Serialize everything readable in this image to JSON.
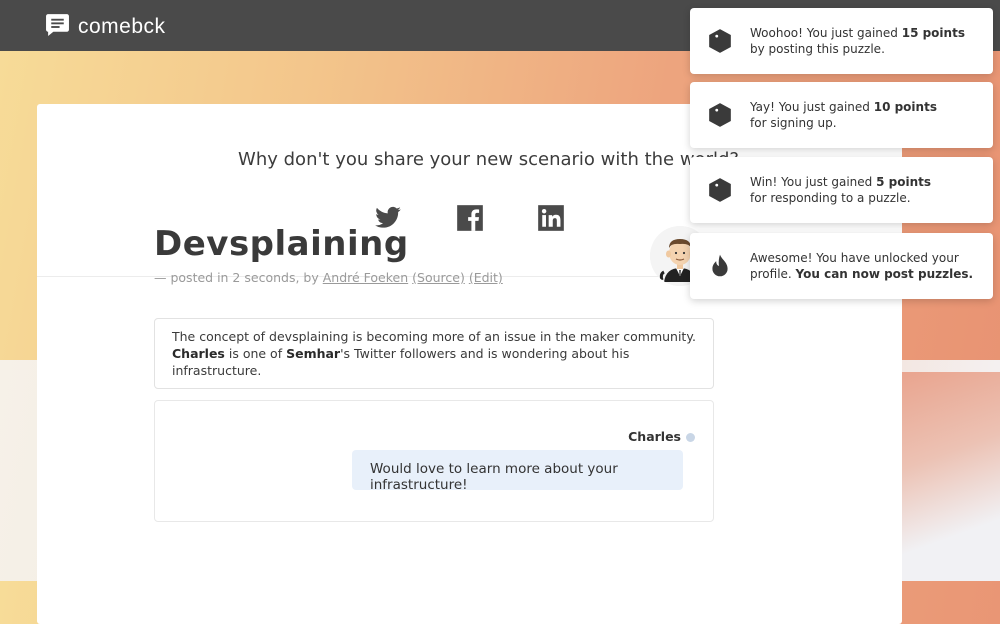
{
  "app": {
    "name": "comebck"
  },
  "share": {
    "prompt": "Why don't you share your new scenario with the world?",
    "icons": [
      "twitter-icon",
      "facebook-icon",
      "linkedin-icon"
    ]
  },
  "post": {
    "title": "Devsplaining",
    "meta_prefix": "— posted in 2 seconds, by",
    "author": "André Foeken",
    "source_label": "(Source)",
    "edit_label": "(Edit)"
  },
  "description": {
    "part1": "The concept of devsplaining is becoming more of an issue in the maker community.",
    "name1": "Charles",
    "part2": "is one of",
    "name2": "Semhar",
    "part3": "'s Twitter followers and is wondering about his infrastructure."
  },
  "chat": {
    "author": "Charles",
    "message": "Would love to learn more about your infrastructure!"
  },
  "notifications": [
    {
      "icon": "cube-icon",
      "line1": "Woohoo! You just gained",
      "bold": "15 points",
      "line2": "by posting this puzzle."
    },
    {
      "icon": "cube-icon",
      "line1": "Yay! You just gained",
      "bold": "10 points",
      "line2": "for signing up."
    },
    {
      "icon": "cube-icon",
      "line1": "Win! You just gained",
      "bold": "5 points",
      "line2": "for responding to a puzzle."
    },
    {
      "icon": "flame-icon",
      "line1": "Awesome! You have unlocked your",
      "line2": "profile.",
      "bold": "You can now post puzzles."
    }
  ],
  "colors": {
    "topbar": "#4a4a4a",
    "card": "#ffffff",
    "bubble": "#e8f0fa"
  }
}
